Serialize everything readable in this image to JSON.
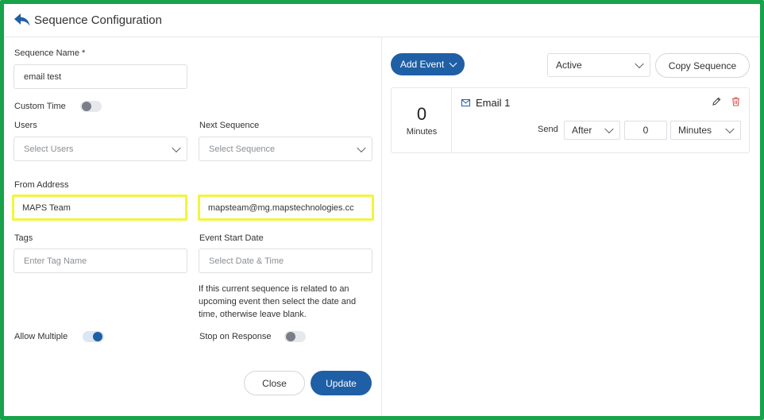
{
  "header": {
    "title": "Sequence Configuration"
  },
  "form": {
    "sequence_name_label": "Sequence Name *",
    "sequence_name_value": "email test",
    "custom_time_label": "Custom Time",
    "users_label": "Users",
    "users_placeholder": "Select Users",
    "next_sequence_label": "Next Sequence",
    "next_sequence_placeholder": "Select Sequence",
    "from_address_label": "From Address",
    "from_name_value": "MAPS Team",
    "from_email_value": "mapsteam@mg.mapstechnologies.cc",
    "tags_label": "Tags",
    "tags_placeholder": "Enter Tag Name",
    "event_start_date_label": "Event Start Date",
    "event_start_date_placeholder": "Select Date & Time",
    "help_text": "If this current sequence is related to an upcoming event then select the date and time, otherwise leave blank.",
    "allow_multiple_label": "Allow Multiple",
    "stop_on_response_label": "Stop on Response",
    "toggles": {
      "custom_time": false,
      "allow_multiple": true,
      "stop_on_response": false
    }
  },
  "footer": {
    "close_label": "Close",
    "update_label": "Update"
  },
  "events_panel": {
    "add_event_label": "Add Event",
    "status_value": "Active",
    "copy_sequence_label": "Copy Sequence",
    "events": [
      {
        "delay_value": "0",
        "delay_unit": "Minutes",
        "name": "Email 1",
        "send_label": "Send",
        "timing_value": "After",
        "amount_value": "0",
        "unit_value": "Minutes"
      }
    ]
  },
  "icons": [
    "back-arrow-icon",
    "chevron-down-icon",
    "mail-icon",
    "pencil-icon",
    "trash-icon"
  ],
  "colors": {
    "frame_border": "#16a34a",
    "primary": "#1f5fa6",
    "highlight": "#f2f53d",
    "delete": "#d9534f"
  }
}
